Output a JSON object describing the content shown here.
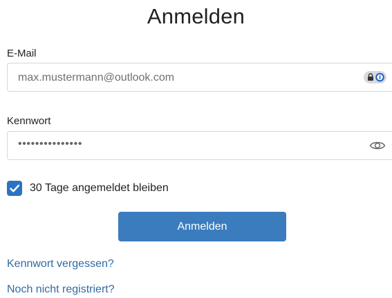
{
  "form": {
    "title": "Anmelden",
    "email": {
      "label": "E-Mail",
      "value": "max.mustermann@outlook.com",
      "password_manager_icon": "password-manager-icon"
    },
    "password": {
      "label": "Kennwort",
      "masked_value": "•••••••••••••••",
      "toggle_icon": "eye-icon"
    },
    "remember": {
      "checked": true,
      "label": "30 Tage angemeldet bleiben"
    },
    "submit_label": "Anmelden",
    "links": {
      "forgot_password": "Kennwort vergessen?",
      "register": "Noch nicht registriert?"
    }
  },
  "colors": {
    "primary_button": "#3a7cbe",
    "checkbox": "#2b73c2",
    "link": "#2f6aa6",
    "field_border": "#d6d6d6"
  }
}
